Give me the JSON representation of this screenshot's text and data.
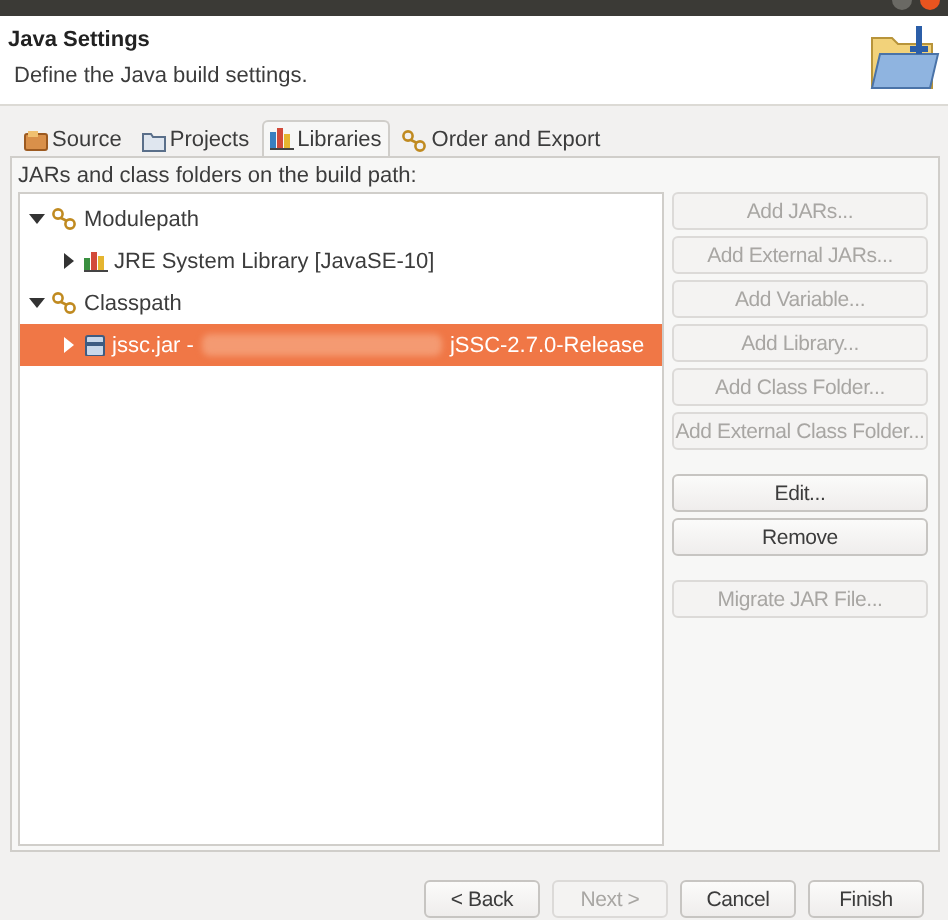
{
  "header": {
    "title": "Java Settings",
    "description": "Define the Java build settings."
  },
  "tabs": [
    {
      "label": "Source",
      "kind": "source",
      "selected": false
    },
    {
      "label": "Projects",
      "kind": "projects",
      "selected": false
    },
    {
      "label": "Libraries",
      "kind": "libraries",
      "selected": true
    },
    {
      "label": "Order and Export",
      "kind": "order",
      "selected": false
    }
  ],
  "tree_label": "JARs and class folders on the build path:",
  "tree": [
    {
      "label": "Modulepath",
      "kind": "path",
      "expanded": true,
      "selected": false,
      "children": [
        {
          "label": "JRE System Library [JavaSE-10]",
          "kind": "library",
          "expanded": false,
          "selected": false
        }
      ]
    },
    {
      "label": "Classpath",
      "kind": "path",
      "expanded": true,
      "selected": false,
      "children": [
        {
          "label": "jssc.jar -",
          "suffix": "jSSC-2.7.0-Release",
          "kind": "jar",
          "expanded": false,
          "selected": true
        }
      ]
    }
  ],
  "side_buttons": [
    {
      "label": "Add JARs...",
      "disabled": true
    },
    {
      "label": "Add External JARs...",
      "disabled": true
    },
    {
      "label": "Add Variable...",
      "disabled": true
    },
    {
      "label": "Add Library...",
      "disabled": true
    },
    {
      "label": "Add Class Folder...",
      "disabled": true
    },
    {
      "label": "Add External Class Folder...",
      "disabled": true
    },
    {
      "label": "Edit...",
      "disabled": false,
      "gap_before": true
    },
    {
      "label": "Remove",
      "disabled": false
    },
    {
      "label": "Migrate JAR File...",
      "disabled": true,
      "gap_before": true
    }
  ],
  "footer_buttons": [
    {
      "label": "< Back",
      "disabled": false
    },
    {
      "label": "Next >",
      "disabled": true
    },
    {
      "label": "Cancel",
      "disabled": false
    },
    {
      "label": "Finish",
      "disabled": false
    }
  ]
}
